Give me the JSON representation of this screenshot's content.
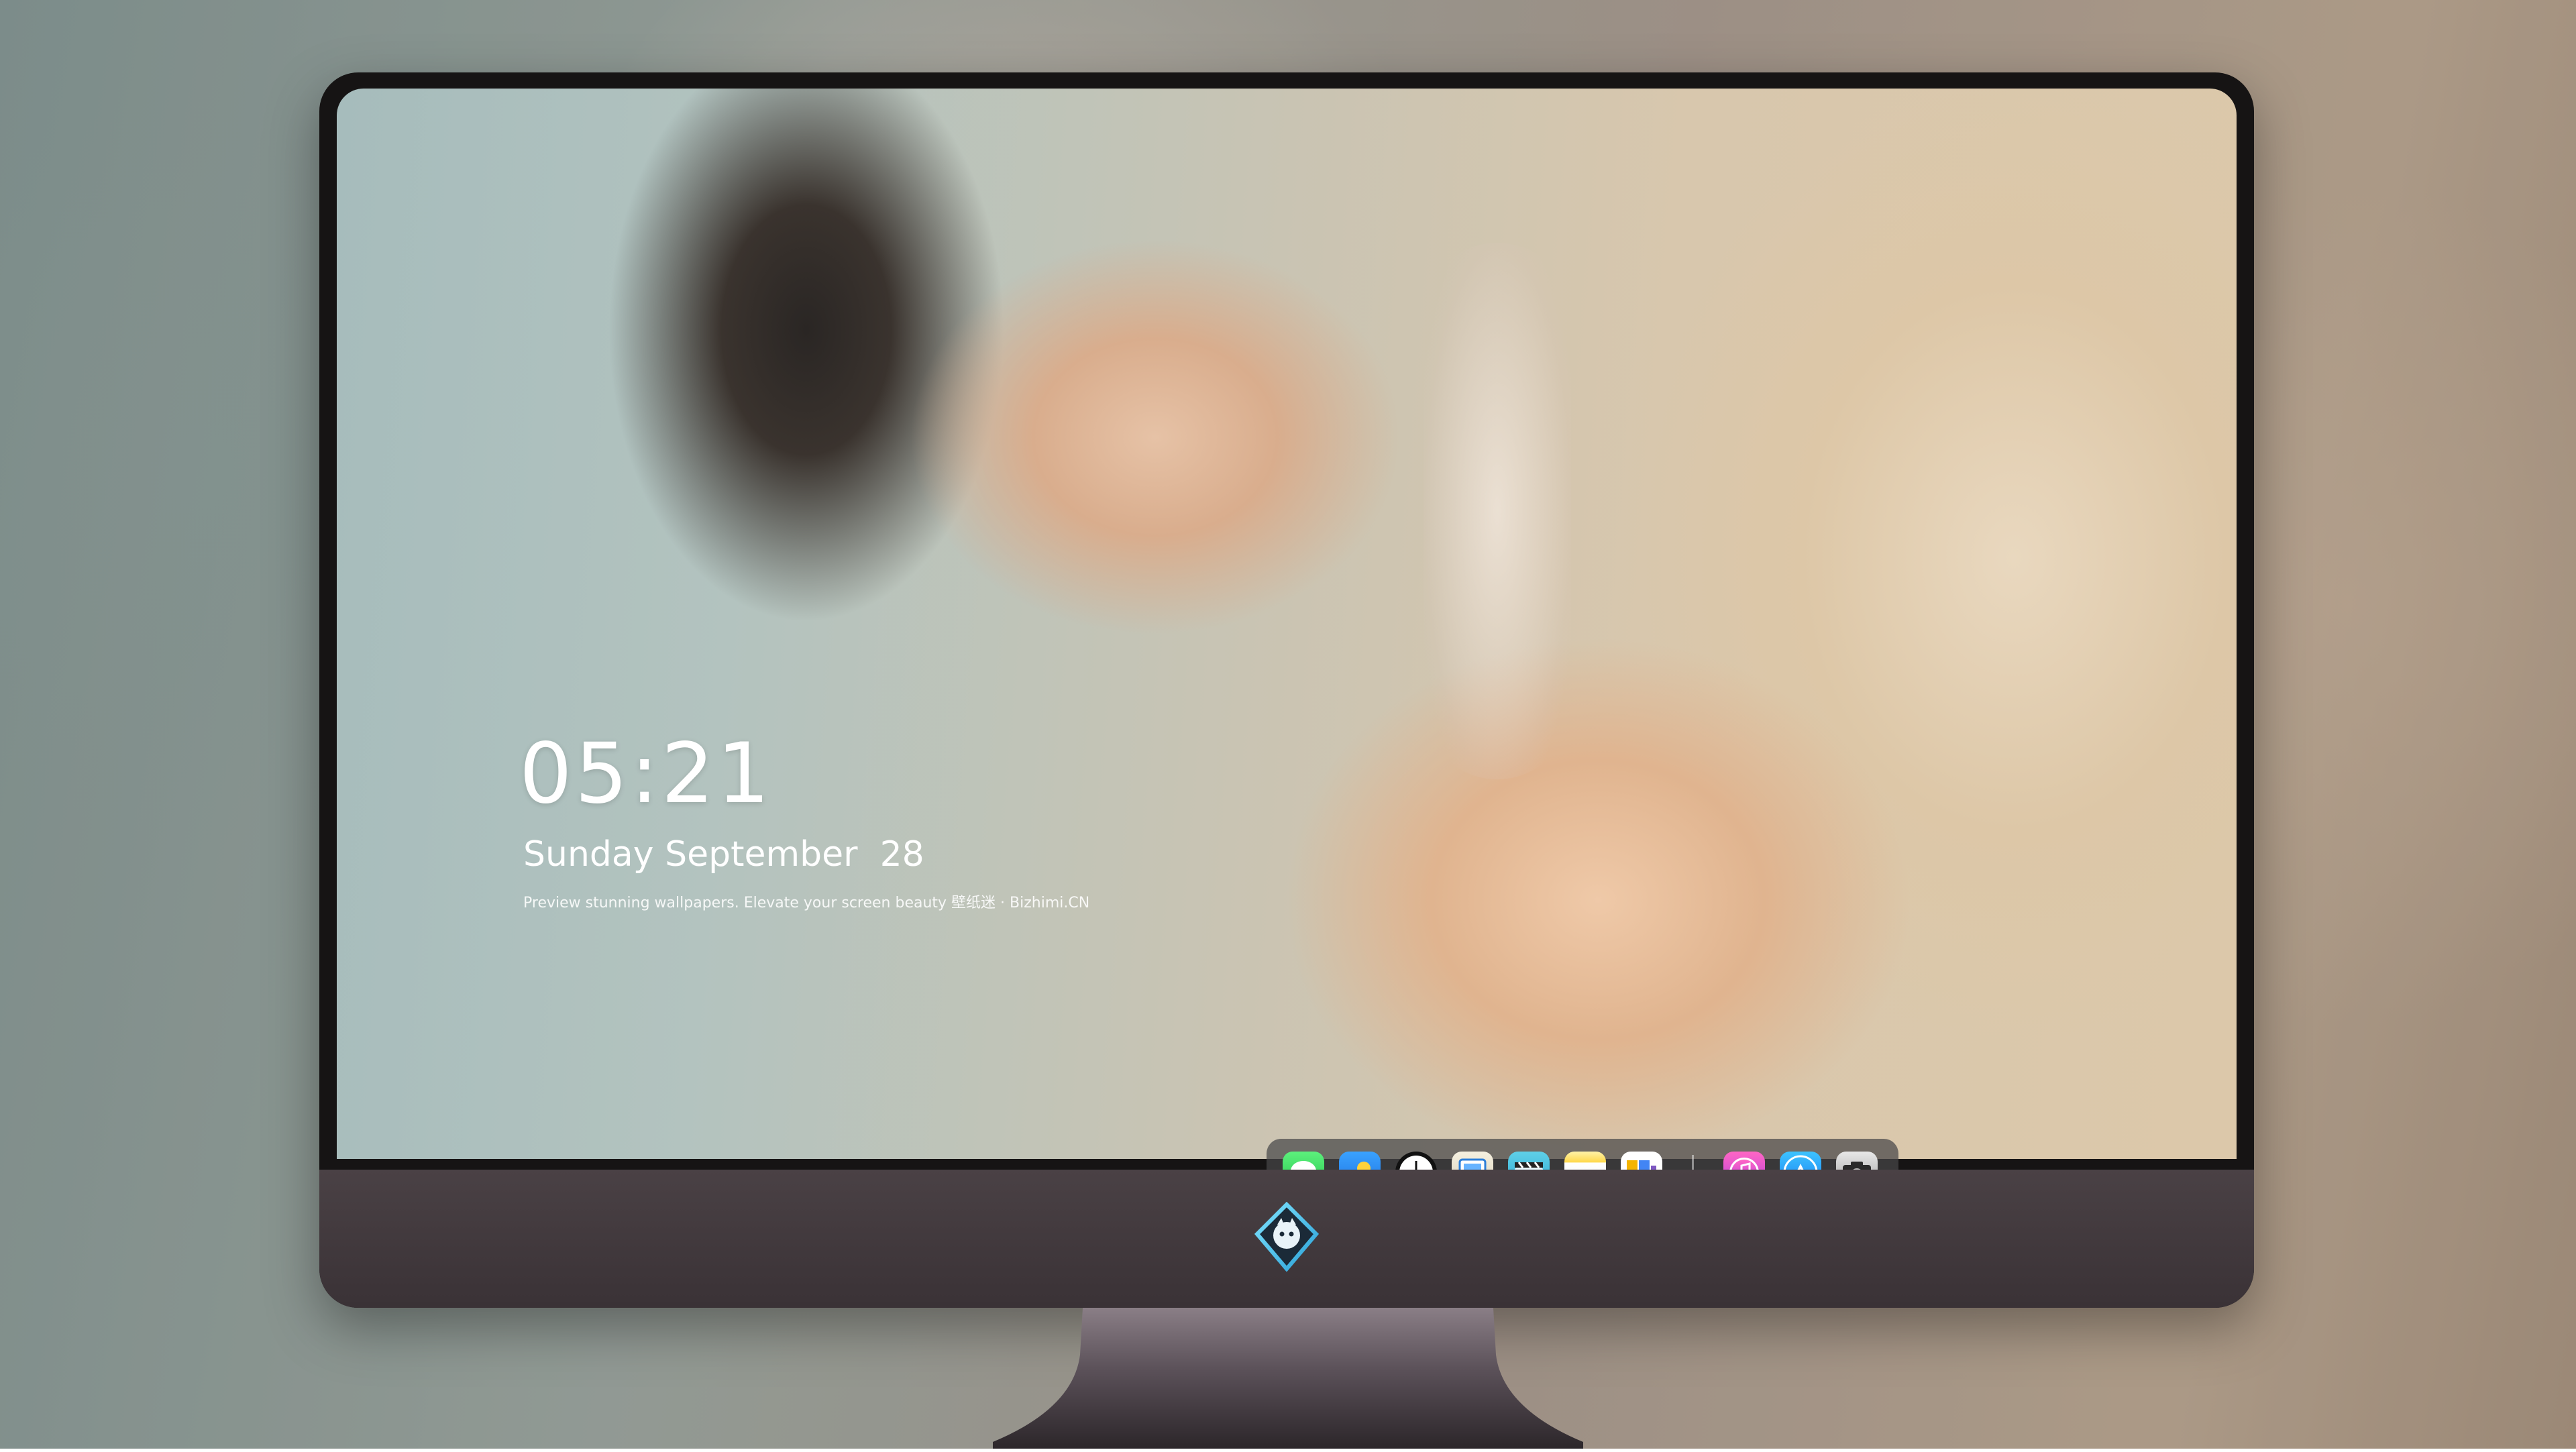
{
  "lock_screen": {
    "time": "05:21",
    "date": "Sunday September  28",
    "tagline": "Preview stunning wallpapers. Elevate your screen beauty  壁纸迷 · Bizhimi.CN"
  },
  "dock": {
    "apps": [
      {
        "name": "messages-icon"
      },
      {
        "name": "weather-icon"
      },
      {
        "name": "clock-icon"
      },
      {
        "name": "preview-icon"
      },
      {
        "name": "video-clapper-icon"
      },
      {
        "name": "notes-icon"
      },
      {
        "name": "photos-icon"
      },
      {
        "name": "music-icon"
      },
      {
        "name": "app-store-icon"
      },
      {
        "name": "camera-icon"
      }
    ]
  },
  "colors": {
    "monitor_bezel": "#161414",
    "chin": "#4a4145",
    "dock_background": "#464648"
  }
}
